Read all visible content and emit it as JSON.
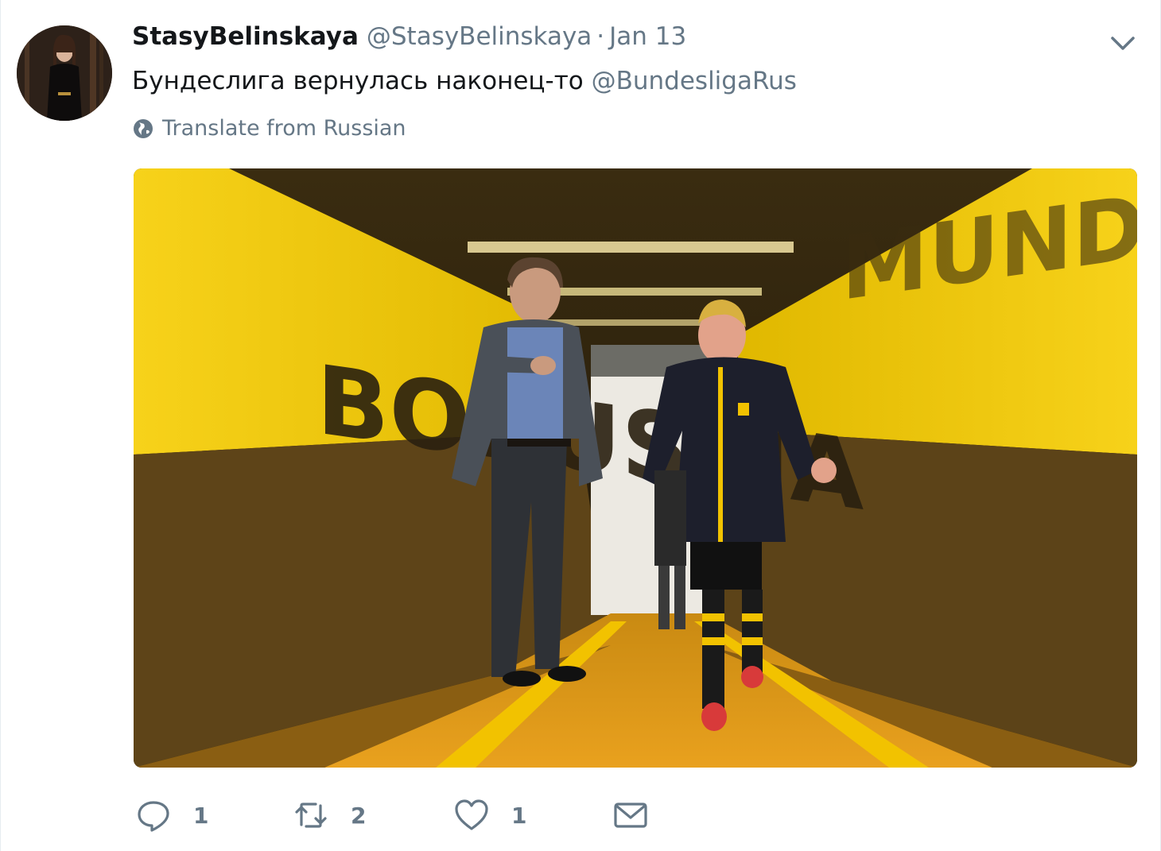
{
  "tweet": {
    "display_name": "StasyBelinskaya",
    "handle": "@StasyBelinskaya",
    "separator": "·",
    "time": "Jan 13",
    "text": "Бундеслига вернулась наконец-то ",
    "mention": "@BundesligaRus",
    "translate_label": "Translate from Russian",
    "media_text_left": "BORUSSIA",
    "media_text_right": "MUND"
  },
  "actions": {
    "reply_count": "1",
    "retweet_count": "2",
    "like_count": "1"
  },
  "icons": {
    "caret": "chevron-down-icon",
    "globe": "globe-icon",
    "reply": "reply-icon",
    "retweet": "retweet-icon",
    "like": "heart-icon",
    "message": "envelope-icon"
  },
  "colors": {
    "text": "#14171a",
    "secondary": "#657786",
    "tunnel_yellow": "#f2c200"
  }
}
